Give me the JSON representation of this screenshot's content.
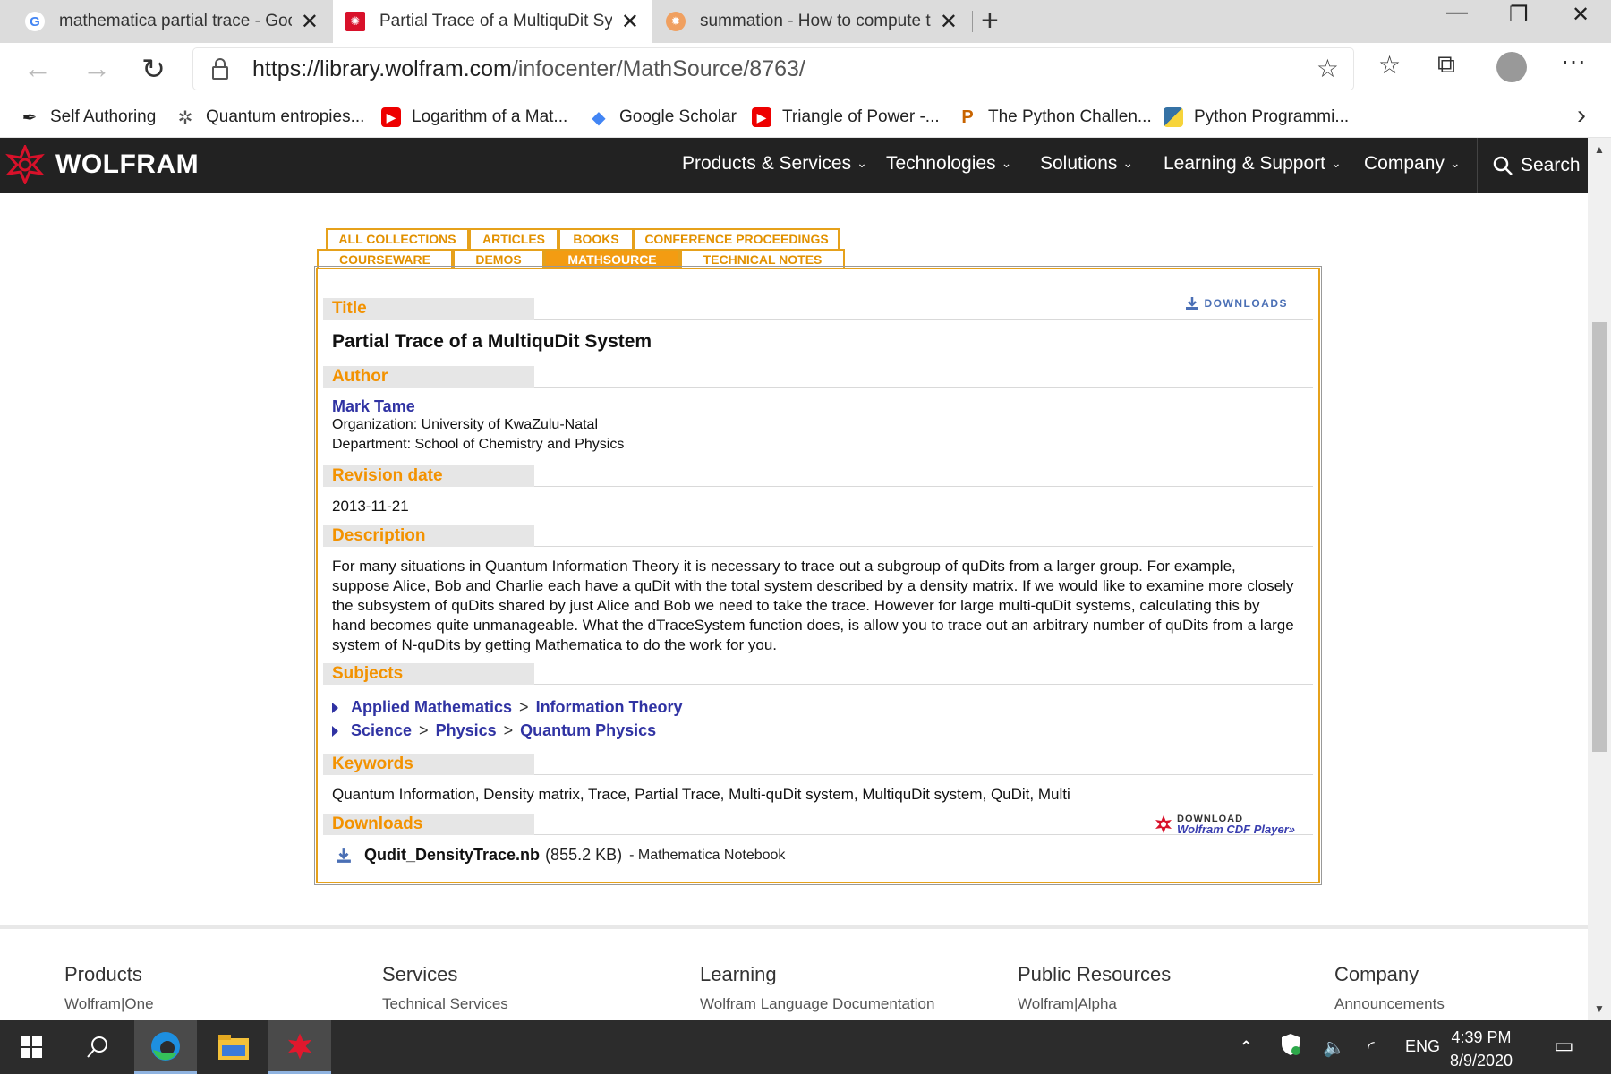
{
  "browser": {
    "tabs": [
      {
        "title": "mathematica partial trace - Goog",
        "favicon": "google-icon"
      },
      {
        "title": "Partial Trace of a MultiquDit Syst",
        "favicon": "wolfram-icon"
      },
      {
        "title": "summation - How to compute th",
        "favicon": "stackexchange-icon"
      }
    ],
    "url_host": "https://library.wolfram.com",
    "url_path": "/infocenter/MathSource/8763/",
    "bookmarks": [
      {
        "label": "Self Authoring",
        "icon": "pen-icon"
      },
      {
        "label": "Quantum entropies...",
        "icon": "gear-icon"
      },
      {
        "label": "Logarithm of a Mat...",
        "icon": "youtube-icon"
      },
      {
        "label": "Google Scholar",
        "icon": "scholar-icon"
      },
      {
        "label": "Triangle of Power -...",
        "icon": "youtube-icon"
      },
      {
        "label": "The Python Challen...",
        "icon": "python-challenge-icon"
      },
      {
        "label": "Python Programmi...",
        "icon": "python-icon"
      }
    ]
  },
  "site": {
    "logo": "WOLFRAM",
    "nav": [
      "Products & Services",
      "Technologies",
      "Solutions",
      "Learning & Support",
      "Company"
    ],
    "search": "Search"
  },
  "collections": {
    "row1": [
      "ALL COLLECTIONS",
      "ARTICLES",
      "BOOKS",
      "CONFERENCE PROCEEDINGS"
    ],
    "row2": [
      "COURSEWARE",
      "DEMOS",
      "MATHSOURCE",
      "TECHNICAL NOTES"
    ],
    "active": "MATHSOURCE"
  },
  "item": {
    "downloads_link": "DOWNLOADS",
    "labels": {
      "title": "Title",
      "author": "Author",
      "revision": "Revision date",
      "description": "Description",
      "subjects": "Subjects",
      "keywords": "Keywords",
      "downloads": "Downloads"
    },
    "title": "Partial Trace of a MultiquDit System",
    "author_name": "Mark Tame",
    "organization": "Organization: University of KwaZulu-Natal",
    "department": "Department: School of Chemistry and Physics",
    "revision_date": "2013-11-21",
    "description": "For many situations in Quantum Information Theory it is necessary to trace out a subgroup of quDits from a larger group. For example, suppose Alice, Bob and Charlie each have a quDit with the total system described by a density matrix. If we would like to examine more closely the subsystem of quDits shared by just Alice and Bob we need to take the trace. However for large multi-quDit systems, calculating this by hand becomes quite unmanageable. What the dTraceSystem function does, is allow you to trace out an arbitrary number of quDits from a large system of N-quDits by getting Mathematica to do the work for you.",
    "subjects": [
      [
        "Applied Mathematics",
        "Information Theory"
      ],
      [
        "Science",
        "Physics",
        "Quantum Physics"
      ]
    ],
    "subject_separator": ">",
    "keywords": "Quantum Information, Density matrix, Trace, Partial Trace, Multi-quDit system, MultiquDit system, QuDit, Multi",
    "cdf": {
      "line1": "DOWNLOAD",
      "line2": "Wolfram CDF Player»"
    },
    "file": {
      "name": "Qudit_DensityTrace.nb",
      "size": "(855.2 KB)",
      "type": "- Mathematica Notebook"
    }
  },
  "footer": [
    {
      "heading": "Products",
      "link": "Wolfram|One"
    },
    {
      "heading": "Services",
      "link": "Technical Services"
    },
    {
      "heading": "Learning",
      "link": "Wolfram Language Documentation"
    },
    {
      "heading": "Public Resources",
      "link": "Wolfram|Alpha"
    },
    {
      "heading": "Company",
      "link": "Announcements"
    }
  ],
  "taskbar": {
    "lang": "ENG",
    "time": "4:39 PM",
    "date": "8/9/2020"
  },
  "colors": {
    "accent": "#f39200",
    "link": "#3033a3",
    "header_bg": "#222222"
  }
}
